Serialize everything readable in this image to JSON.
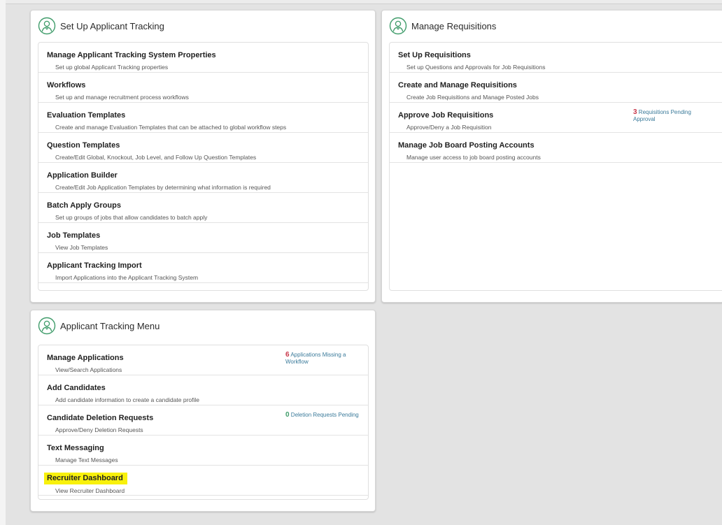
{
  "colors": {
    "accent": "#3f9c6a",
    "badge_text": "#3a7a9a",
    "count_alert": "#c8374a",
    "count_ok": "#3f9c6a",
    "highlight": "#f8f10c"
  },
  "panel_setup": {
    "icon": "recruiter-avatar-icon",
    "title": "Set Up Applicant Tracking",
    "items": [
      {
        "title": "Manage Applicant Tracking System Properties",
        "desc": "Set up global Applicant Tracking properties"
      },
      {
        "title": "Workflows",
        "desc": "Set up and manage recruitment process workflows"
      },
      {
        "title": "Evaluation Templates",
        "desc": "Create and manage Evaluation Templates that can be attached to global workflow steps"
      },
      {
        "title": "Question Templates",
        "desc": "Create/Edit Global, Knockout, Job Level, and Follow Up Question Templates"
      },
      {
        "title": "Application Builder",
        "desc": "Create/Edit Job Application Templates by determining what information is required"
      },
      {
        "title": "Batch Apply Groups",
        "desc": "Set up groups of jobs that allow candidates to batch apply"
      },
      {
        "title": "Job Templates",
        "desc": "View Job Templates"
      },
      {
        "title": "Applicant Tracking Import",
        "desc": "Import Applications into the Applicant Tracking System"
      }
    ]
  },
  "panel_requisitions": {
    "icon": "recruiter-avatar-icon",
    "title": "Manage Requisitions",
    "items": [
      {
        "title": "Set Up Requisitions",
        "desc": "Set up Questions and Approvals for Job Requisitions"
      },
      {
        "title": "Create and Manage Requisitions",
        "desc": "Create Job Requisitions and Manage Posted Jobs"
      },
      {
        "title": "Approve Job Requisitions",
        "desc": "Approve/Deny a Job Requisition",
        "badge_count": "3",
        "badge_text": "Requisitions Pending Approval"
      },
      {
        "title": "Manage Job Board Posting Accounts",
        "desc": "Manage user access to job board posting accounts"
      }
    ]
  },
  "panel_menu": {
    "icon": "recruiter-avatar-icon",
    "title": "Applicant Tracking Menu",
    "items": [
      {
        "title": "Manage Applications",
        "desc": "View/Search Applications",
        "badge_count": "6",
        "badge_text": "Applications Missing a Workflow"
      },
      {
        "title": "Add Candidates",
        "desc": "Add candidate information to create a candidate profile"
      },
      {
        "title": "Candidate Deletion Requests",
        "desc": "Approve/Deny Deletion Requests",
        "badge_count": "0",
        "badge_text": "Deletion Requests Pending"
      },
      {
        "title": "Text Messaging",
        "desc": "Manage Text Messages"
      },
      {
        "title": "Recruiter Dashboard",
        "desc": "View Recruiter Dashboard"
      }
    ]
  }
}
